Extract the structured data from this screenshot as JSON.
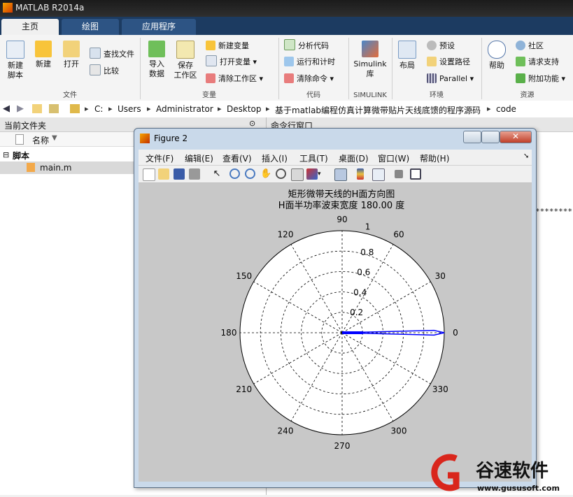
{
  "app": {
    "title": "MATLAB R2014a"
  },
  "tabs": [
    {
      "label": "主页"
    },
    {
      "label": "绘图"
    },
    {
      "label": "应用程序"
    }
  ],
  "ribbon": {
    "file": {
      "new_script": "新建\n脚本",
      "new": "新建",
      "open": "打开",
      "find_files": "查找文件",
      "compare": "比较",
      "group": "文件"
    },
    "variable": {
      "import": "导入\n数据",
      "save_ws": "保存\n工作区",
      "new_var": "新建变量",
      "open_var": "打开变量",
      "clear_ws": "清除工作区",
      "group": "变量"
    },
    "code": {
      "analyze": "分析代码",
      "run_time": "运行和计时",
      "clear_cmd": "清除命令",
      "group": "代码"
    },
    "simulink": {
      "library": "Simulink\n库",
      "group": "SIMULINK"
    },
    "env": {
      "layout": "布局",
      "prefs": "预设",
      "set_path": "设置路径",
      "parallel": "Parallel",
      "group": "环境"
    },
    "resources": {
      "help": "帮助",
      "community": "社区",
      "request_support": "请求支持",
      "addons": "附加功能",
      "group": "资源"
    }
  },
  "address": {
    "path": [
      "C:",
      "Users",
      "Administrator",
      "Desktop",
      "基于matlab编程仿真计算微带贴片天线底馈的程序源码",
      "code"
    ]
  },
  "left_panel": {
    "title": "当前文件夹",
    "col_name": "名称",
    "group": "脚本",
    "file": "main.m"
  },
  "right_panel": {
    "title": "命令行窗口",
    "stars": "*********"
  },
  "figure": {
    "title": "Figure 2",
    "menus": [
      "文件(F)",
      "编辑(E)",
      "查看(V)",
      "插入(I)",
      "工具(T)",
      "桌面(D)",
      "窗口(W)",
      "帮助(H)"
    ],
    "plot_title": "矩形微带天线的H面方向图",
    "plot_subtitle": "H面半功率波束宽度 180.00 度"
  },
  "chart_data": {
    "type": "line",
    "subtype": "polar",
    "title": "矩形微带天线的H面方向图",
    "subtitle": "H面半功率波束宽度 180.00 度",
    "angle_ticks": [
      90,
      60,
      30,
      0,
      330,
      300,
      270,
      240,
      210,
      180,
      150,
      120
    ],
    "radial_ticks": [
      0.2,
      0.4,
      0.6,
      0.8,
      1
    ],
    "rlim": [
      0,
      1
    ],
    "series": [
      {
        "color": "#0000ff",
        "theta_deg": [
          -3,
          -1.5,
          0,
          1.5,
          3,
          0,
          -3
        ],
        "r": [
          0.0,
          0.9,
          1.0,
          0.9,
          0.0,
          0.0,
          0.0
        ]
      }
    ]
  },
  "watermark": {
    "brand": "谷速软件",
    "url": "www.gususoft.com"
  },
  "colors": {
    "tabbar": "#1c3b61",
    "plot_line": "#0000ff",
    "figure_bg": "#c8c8c8"
  }
}
